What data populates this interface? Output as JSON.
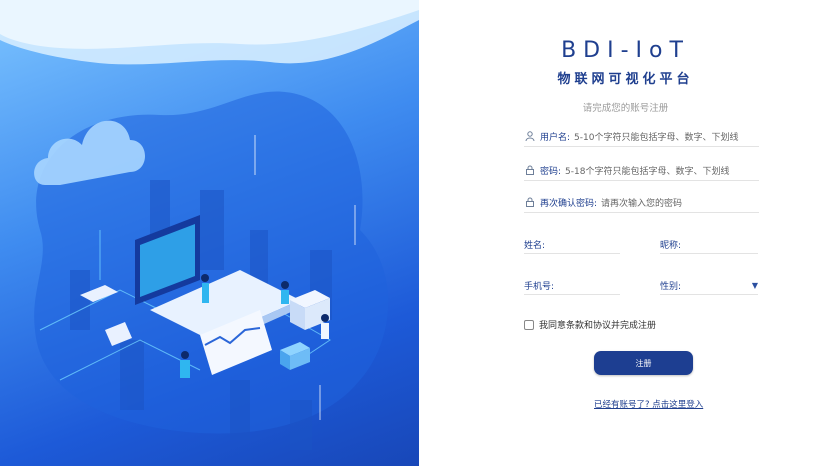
{
  "brand": {
    "title": "BDI-IoT",
    "subtitle": "物联网可视化平台"
  },
  "form": {
    "hint": "请完成您的账号注册",
    "username": {
      "label": "用户名:",
      "placeholder": "5-10个字符只能包括字母、数字、下划线",
      "icon": "user-icon"
    },
    "password": {
      "label": "密码:",
      "placeholder": "5-18个字符只能包括字母、数字、下划线",
      "icon": "lock-icon"
    },
    "confirm": {
      "label": "再次确认密码:",
      "placeholder": "请再次输入您的密码",
      "icon": "lock-icon"
    },
    "name_label": "姓名:",
    "nickname_label": "昵称:",
    "phone_label": "手机号:",
    "gender_label": "性别:",
    "agree_label": "我同意条款和协议并完成注册",
    "agree_checked": false,
    "submit_label": "注册",
    "login_link": "已经有账号了? 点击这里登入"
  },
  "colors": {
    "brand": "#1f3f8f",
    "button": "#1d3e91",
    "panel": "#3f8cf0"
  }
}
